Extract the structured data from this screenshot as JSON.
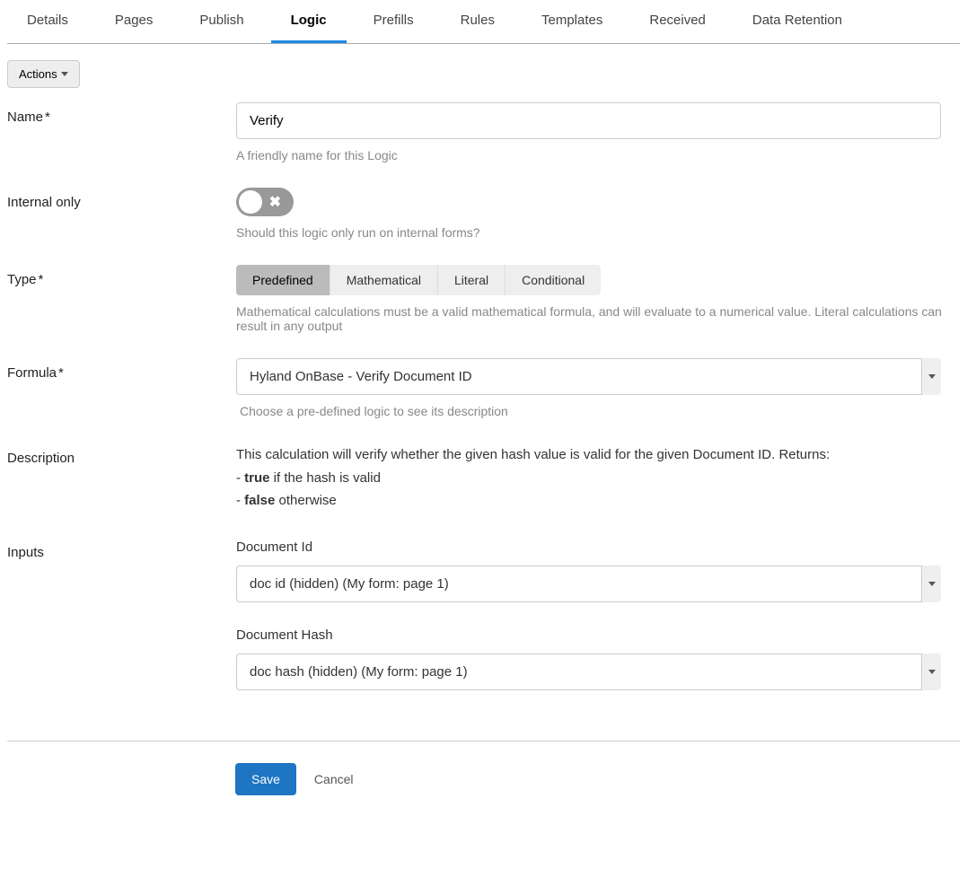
{
  "tabs": [
    "Details",
    "Pages",
    "Publish",
    "Logic",
    "Prefills",
    "Rules",
    "Templates",
    "Received",
    "Data Retention"
  ],
  "active_tab": "Logic",
  "actions_label": "Actions",
  "form": {
    "name": {
      "label": "Name",
      "value": "Verify",
      "help": "A friendly name for this Logic"
    },
    "internal": {
      "label": "Internal only",
      "help": "Should this logic only run on internal forms?"
    },
    "type": {
      "label": "Type",
      "options": [
        "Predefined",
        "Mathematical",
        "Literal",
        "Conditional"
      ],
      "selected": "Predefined",
      "help": "Mathematical calculations must be a valid mathematical formula, and will evaluate to a numerical value. Literal calculations can result in any output"
    },
    "formula": {
      "label": "Formula",
      "value": "Hyland OnBase - Verify Document ID",
      "help": "Choose a pre-defined logic to see its description"
    },
    "description": {
      "label": "Description",
      "line1": "This calculation will verify whether the given hash value is valid for the given Document ID. Returns:",
      "line2_prefix": "- ",
      "line2_bold": "true",
      "line2_suffix": " if the hash is valid",
      "line3_prefix": "- ",
      "line3_bold": "false",
      "line3_suffix": " otherwise"
    },
    "inputs": {
      "label": "Inputs",
      "items": [
        {
          "label": "Document Id",
          "value": "doc id (hidden) (My form: page 1)"
        },
        {
          "label": "Document Hash",
          "value": "doc hash (hidden) (My form: page 1)"
        }
      ]
    }
  },
  "footer": {
    "save": "Save",
    "cancel": "Cancel"
  },
  "star": "*"
}
